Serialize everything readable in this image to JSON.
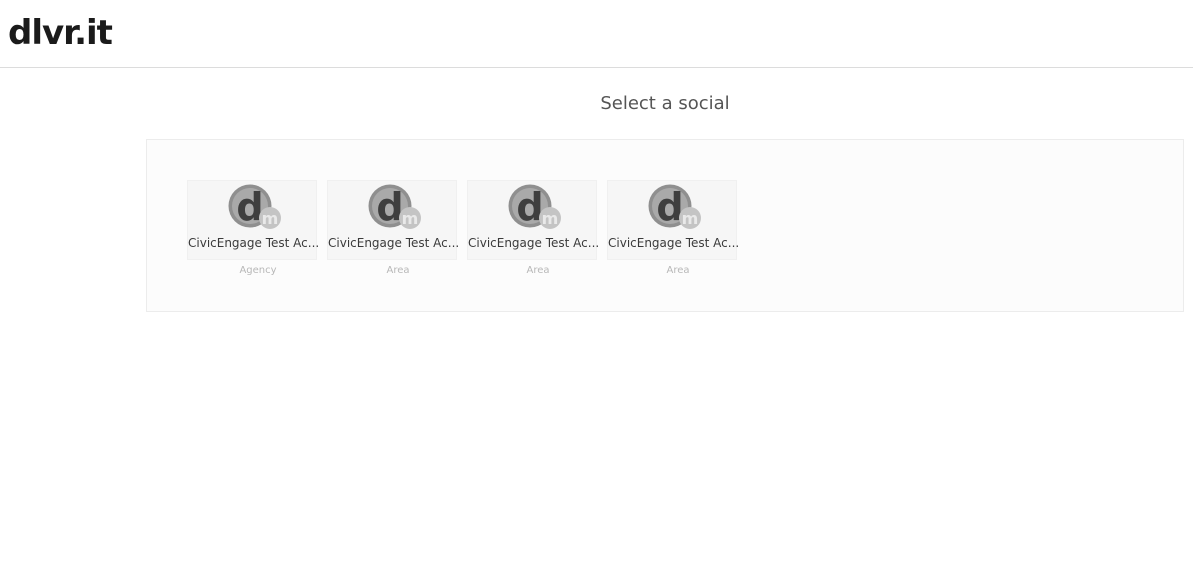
{
  "header": {
    "logo_text": "dlvr.it"
  },
  "main": {
    "title": "Select a social",
    "cards": [
      {
        "name": "CivicEngage Test Ac...",
        "type": "Agency",
        "icon": "dm-avatar-icon"
      },
      {
        "name": "CivicEngage Test Ac...",
        "type": "Area",
        "icon": "dm-avatar-icon"
      },
      {
        "name": "CivicEngage Test Ac...",
        "type": "Area",
        "icon": "dm-avatar-icon"
      },
      {
        "name": "CivicEngage Test Ac...",
        "type": "Area",
        "icon": "dm-avatar-icon"
      }
    ]
  },
  "colors": {
    "avatar_dark": "#8a8a8a",
    "avatar_light": "#b5b5b5",
    "background": "#ffffff",
    "panel": "#fcfcfc"
  }
}
